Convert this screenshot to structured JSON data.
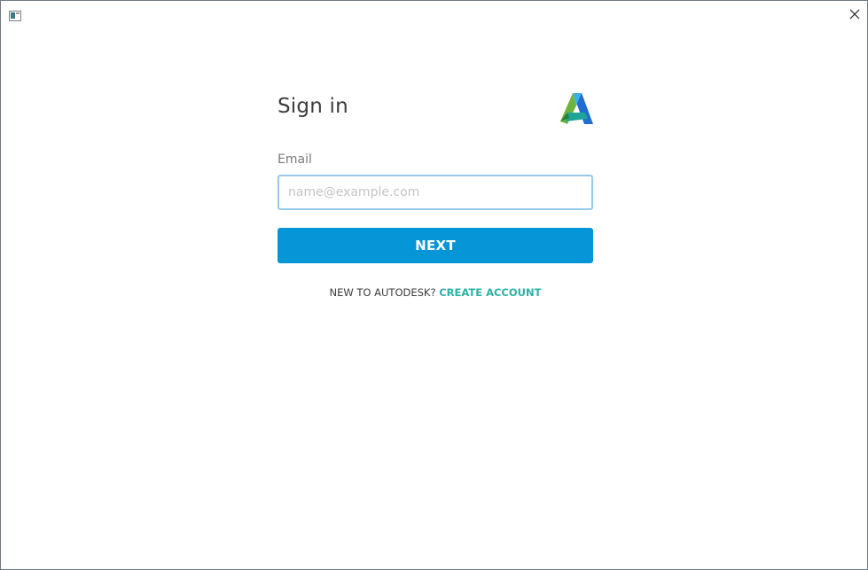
{
  "window": {
    "icon": "window-app-icon",
    "close_icon": "close-icon"
  },
  "signin": {
    "title": "Sign in",
    "logo": "autodesk-logo",
    "email_label": "Email",
    "email_value": "",
    "email_placeholder": "name@example.com",
    "next_label": "NEXT",
    "signup_prompt": "NEW TO AUTODESK?",
    "create_account_label": "CREATE ACCOUNT"
  },
  "colors": {
    "primary_button": "#0696d7",
    "link": "#2bb3a3",
    "input_focus_border": "#97c9ea"
  }
}
